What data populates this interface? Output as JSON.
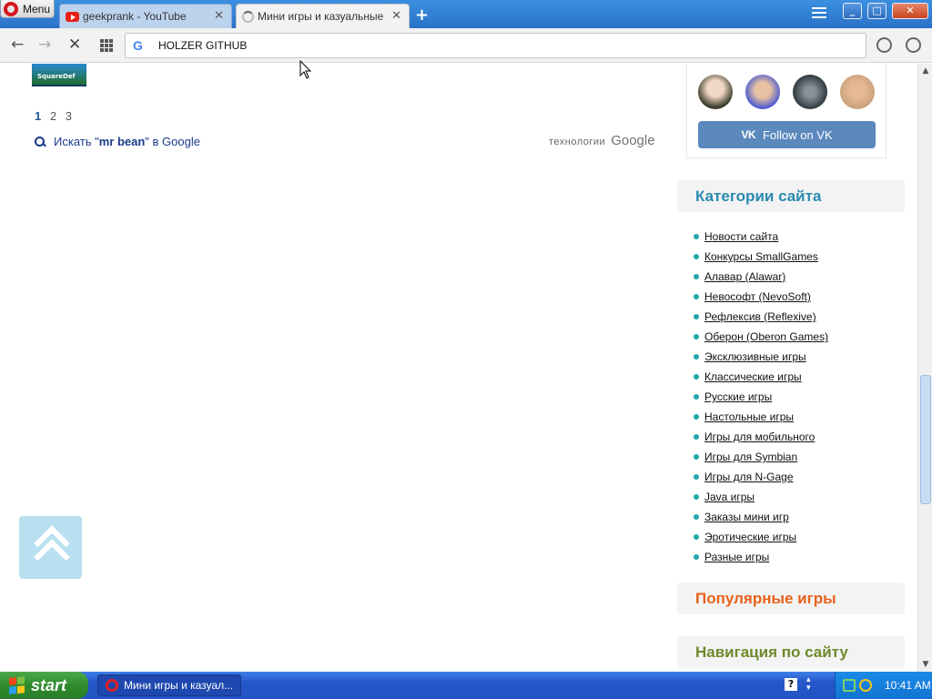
{
  "browser": {
    "menu_label": "Menu",
    "tabs": [
      {
        "title": "geekprank - YouTube",
        "icon": "youtube-icon",
        "active": false
      },
      {
        "title": "Мини игры и казуальные иг",
        "icon": "loading-spinner-icon",
        "active": true
      }
    ],
    "close_glyph": "✕",
    "newtab_glyph": "+",
    "address": "HOLZER GITHUB"
  },
  "window_controls": {
    "minimize": "_",
    "maximize": "□",
    "close": "✕"
  },
  "nav": {
    "back": "←",
    "forward": "→",
    "stop": "✕"
  },
  "results": {
    "thumb_caption": "SquareDef",
    "pages": [
      "1",
      "2",
      "3"
    ],
    "current_page": "1",
    "search_prefix": "Искать \"",
    "search_query": "mr bean",
    "search_suffix": "\" в Google",
    "powered_label": "технологии",
    "powered_brand": "Google"
  },
  "sidebar": {
    "vk_follow_label": "Follow on VK",
    "vk_logo": "VK",
    "categories_title": "Категории сайта",
    "categories": [
      "Новости сайта",
      "Конкурсы SmallGames",
      "Алавар (Alawar)",
      "Невософт (NevoSoft)",
      "Рефлексив (Reflexive)",
      "Оберон (Oberon Games)",
      "Эксклюзивные игры",
      "Классические игры",
      "Русские игры",
      "Настольные игры",
      "Игры для мобильного",
      "Игры для Symbian",
      "Игры для N-Gage",
      "Java игры",
      "Заказы мини игр",
      "Эротические игры",
      "Разные игры"
    ],
    "popular_title": "Популярные игры",
    "navigation_title": "Навигация по сайту"
  },
  "taskbar": {
    "start_label": "start",
    "task_label": "Мини игры и казуал...",
    "help_glyph": "?",
    "clock": "10:41 AM"
  },
  "colors": {
    "accent_blue": "#2a8ab0",
    "popular_orange": "#e8621b",
    "navigation_green": "#6d8a2a",
    "vk_blue": "#5b88bd",
    "bullet_teal": "#1fa8a8"
  }
}
